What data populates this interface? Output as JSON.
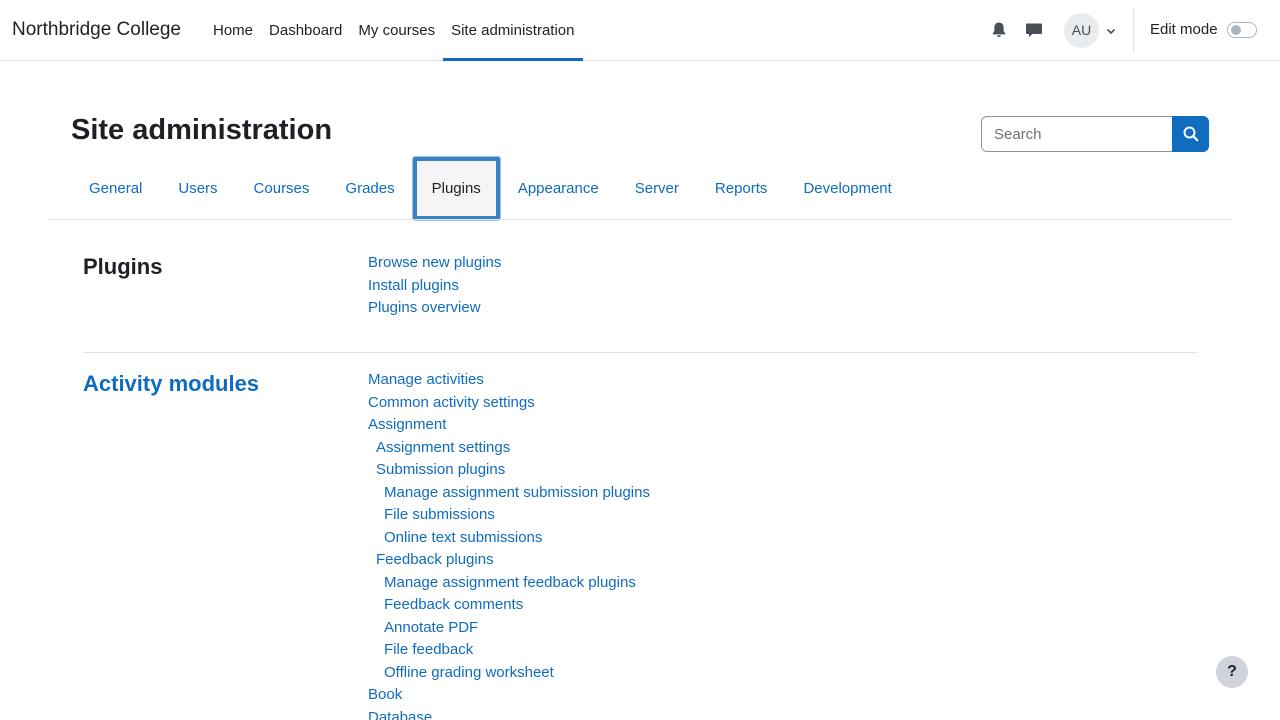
{
  "navbar": {
    "brand": "Northbridge College",
    "items": [
      {
        "label": "Home"
      },
      {
        "label": "Dashboard"
      },
      {
        "label": "My courses"
      },
      {
        "label": "Site administration",
        "active": true
      }
    ],
    "avatar_initials": "AU",
    "edit_mode_label": "Edit mode",
    "edit_mode_on": false,
    "icons": [
      "bell-icon",
      "message-icon",
      "chevron-down-icon"
    ]
  },
  "page": {
    "title": "Site administration",
    "search": {
      "placeholder": "Search",
      "value": ""
    }
  },
  "tabs": [
    {
      "label": "General"
    },
    {
      "label": "Users"
    },
    {
      "label": "Courses"
    },
    {
      "label": "Grades"
    },
    {
      "label": "Plugins",
      "active": true
    },
    {
      "label": "Appearance"
    },
    {
      "label": "Server"
    },
    {
      "label": "Reports"
    },
    {
      "label": "Development"
    }
  ],
  "sections": {
    "plugins": {
      "title": "Plugins",
      "links": [
        {
          "label": "Browse new plugins",
          "level": 0
        },
        {
          "label": "Install plugins",
          "level": 0
        },
        {
          "label": "Plugins overview",
          "level": 0
        }
      ]
    },
    "activity_modules": {
      "title": "Activity modules",
      "links": [
        {
          "label": "Manage activities",
          "level": 0
        },
        {
          "label": "Common activity settings",
          "level": 0
        },
        {
          "label": "Assignment",
          "level": 0
        },
        {
          "label": "Assignment settings",
          "level": 1
        },
        {
          "label": "Submission plugins",
          "level": 1
        },
        {
          "label": "Manage assignment submission plugins",
          "level": 2
        },
        {
          "label": "File submissions",
          "level": 2
        },
        {
          "label": "Online text submissions",
          "level": 2
        },
        {
          "label": "Feedback plugins",
          "level": 1
        },
        {
          "label": "Manage assignment feedback plugins",
          "level": 2
        },
        {
          "label": "Feedback comments",
          "level": 2
        },
        {
          "label": "Annotate PDF",
          "level": 2
        },
        {
          "label": "File feedback",
          "level": 2
        },
        {
          "label": "Offline grading worksheet",
          "level": 2
        },
        {
          "label": "Book",
          "level": 0
        },
        {
          "label": "Database",
          "level": 0
        }
      ]
    }
  },
  "help_label": "?",
  "colors": {
    "accent": "#0f6cbf",
    "text": "#1d2125",
    "border": "#dee2e6"
  }
}
